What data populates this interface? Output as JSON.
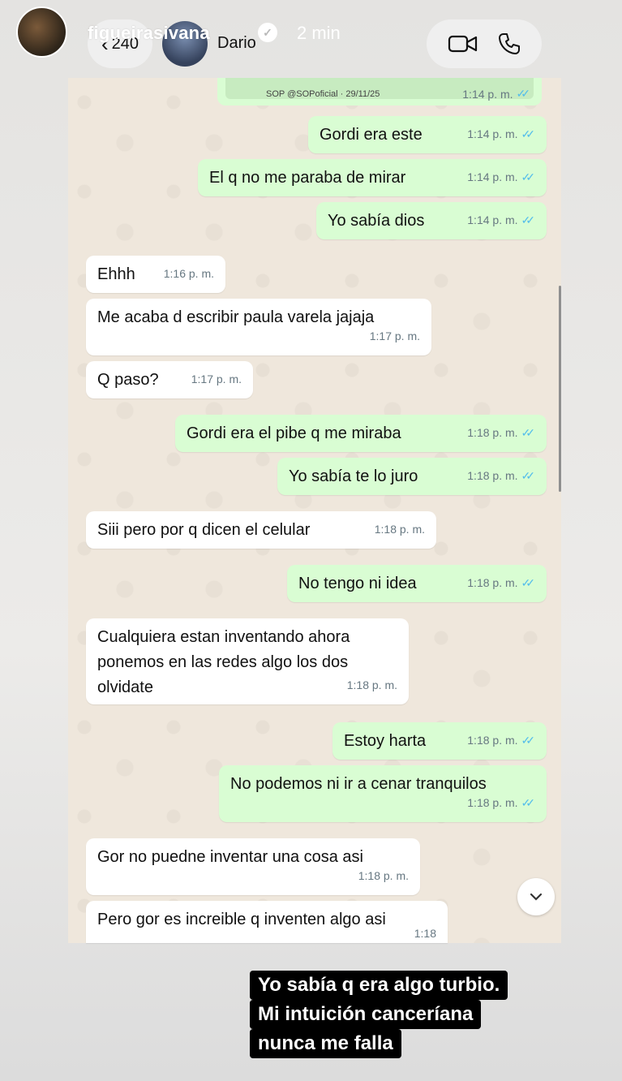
{
  "story": {
    "username": "figueirasivana",
    "time": "2 min",
    "verified_mark": "✓"
  },
  "chat_header": {
    "back_count": "240",
    "contact_name": "Dario"
  },
  "quoted": {
    "text": "SOP @SOPoficial · 29/11/25",
    "time": "1:14 p. m."
  },
  "messages": [
    {
      "dir": "out",
      "text": "Gordi era este",
      "time": "1:14 p. m."
    },
    {
      "dir": "out",
      "text": "El q no me paraba de mirar",
      "time": "1:14 p. m."
    },
    {
      "dir": "out",
      "text": "Yo sabía dios",
      "time": "1:14 p. m."
    },
    {
      "dir": "in",
      "text": "Ehhh",
      "time": "1:16 p. m."
    },
    {
      "dir": "in",
      "text": "Me acaba d escribir paula varela jajaja",
      "time": "1:17 p. m."
    },
    {
      "dir": "in",
      "text": "Q paso?",
      "time": "1:17 p. m."
    },
    {
      "dir": "out",
      "text": "Gordi era el pibe q me miraba",
      "time": "1:18 p. m."
    },
    {
      "dir": "out",
      "text": "Yo sabía te lo juro",
      "time": "1:18 p. m."
    },
    {
      "dir": "in",
      "text": "Siii pero por q dicen el celular",
      "time": "1:18 p. m."
    },
    {
      "dir": "out",
      "text": "No tengo ni idea",
      "time": "1:18 p. m."
    },
    {
      "dir": "in",
      "text": "Cualquiera estan inventando ahora\nponemos en las redes algo los dos\nolvidate",
      "time": "1:18 p. m."
    },
    {
      "dir": "out",
      "text": "Estoy harta",
      "time": "1:18 p. m."
    },
    {
      "dir": "out",
      "text": "No podemos ni ir a cenar tranquilos",
      "time": "1:18 p. m."
    },
    {
      "dir": "in",
      "text": "Gor no puedne inventar una cosa asi",
      "time": "1:18 p. m."
    },
    {
      "dir": "in",
      "text": "Pero gor es increible q inventen algo asi",
      "time": "1:18"
    }
  ],
  "caption": {
    "line1": "Yo sabía q era algo turbio.",
    "line2": "Mi intuición canceríana",
    "line3": "nunca me falla"
  },
  "colors": {
    "outgoing_bubble": "#d9fdd3",
    "incoming_bubble": "#ffffff",
    "read_ticks": "#53bdeb",
    "chat_bg": "#efe7dc"
  }
}
